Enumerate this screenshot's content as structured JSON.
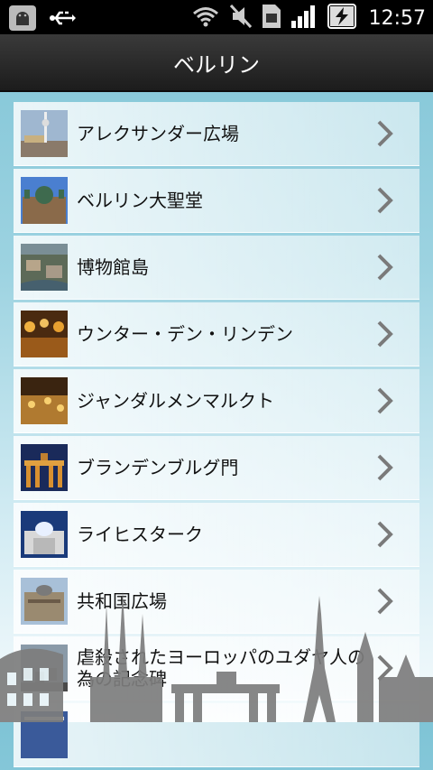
{
  "status_bar": {
    "time": "12:57",
    "icons": [
      "android-debug-icon",
      "usb-icon",
      "wifi-icon",
      "mute-icon",
      "sim-icon",
      "signal-icon",
      "battery-charging-icon"
    ]
  },
  "header": {
    "title": "ベルリン"
  },
  "list": {
    "items": [
      {
        "label": "アレクサンダー広場",
        "thumb": "alexanderplatz-thumb"
      },
      {
        "label": "ベルリン大聖堂",
        "thumb": "berlin-cathedral-thumb"
      },
      {
        "label": "博物館島",
        "thumb": "museum-island-thumb"
      },
      {
        "label": "ウンター・デン・リンデン",
        "thumb": "unter-den-linden-thumb"
      },
      {
        "label": "ジャンダルメンマルクト",
        "thumb": "gendarmenmarkt-thumb"
      },
      {
        "label": "ブランデンブルグ門",
        "thumb": "brandenburg-gate-thumb"
      },
      {
        "label": "ライヒスターク",
        "thumb": "reichstag-thumb"
      },
      {
        "label": "共和国広場",
        "thumb": "republic-square-thumb"
      },
      {
        "label": "虐殺されたヨーロッパのユダヤ人の為の記念碑",
        "thumb": "holocaust-memorial-thumb"
      },
      {
        "label": "",
        "thumb": "partial-thumb"
      }
    ]
  },
  "colors": {
    "background_top": "#7fc4d6",
    "background_bottom": "#f6fbfd",
    "titlebar": "#2a2a2a",
    "chevron": "#7a7a7a",
    "skyline": "#7d7d7d"
  }
}
